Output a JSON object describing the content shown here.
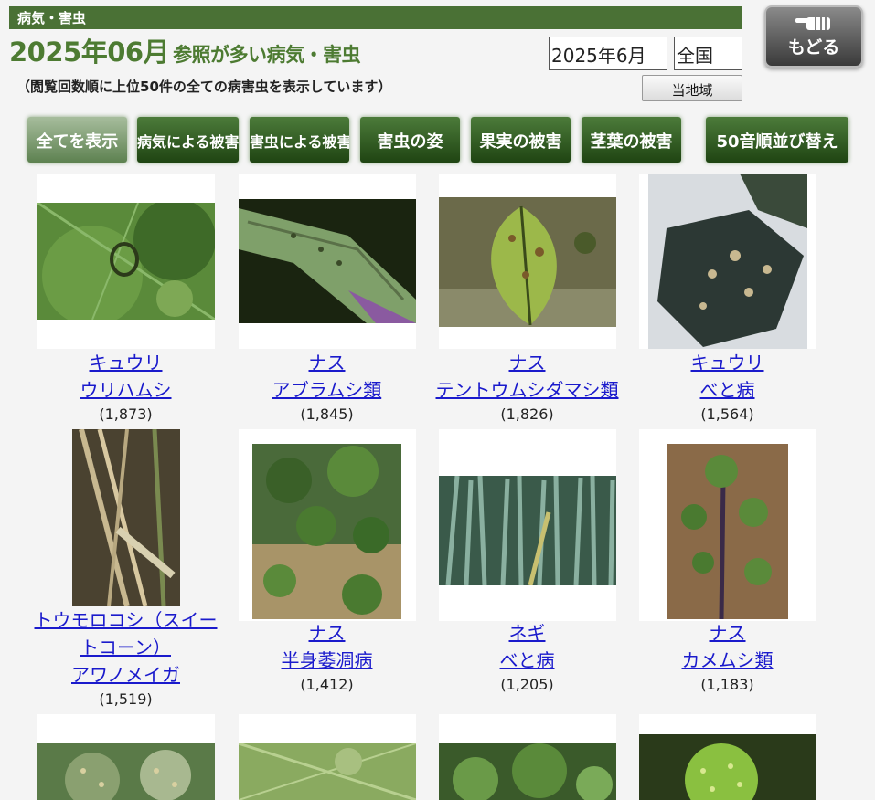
{
  "header": {
    "section": "病気・害虫",
    "title_main": "2025年06月",
    "title_sub": "参照が多い病気・害虫",
    "note": "（閲覧回数順に上位50件の全ての病害虫を表示しています）"
  },
  "controls": {
    "month": "2025年6月",
    "area": "全国",
    "local_button": "当地域",
    "back_button": "もどる"
  },
  "filters": [
    "全てを表示",
    "病気による被害",
    "害虫による被害",
    "害虫の姿",
    "果実の被害",
    "茎葉の被害",
    "50音順並び替え"
  ],
  "items": [
    {
      "crop": "キュウリ",
      "name": "ウリハムシ",
      "count": "(1,873)"
    },
    {
      "crop": "ナス",
      "name": "アブラムシ類",
      "count": "(1,845)"
    },
    {
      "crop": "ナス",
      "name": "テントウムシダマシ類",
      "count": "(1,826)"
    },
    {
      "crop": "キュウリ",
      "name": "べと病",
      "count": "(1,564)"
    },
    {
      "crop_line1": "トウモロコシ（スイー",
      "crop_line2": "トコーン）",
      "name": "アワノメイガ",
      "count": "(1,519)"
    },
    {
      "crop": "ナス",
      "name": "半身萎凋病",
      "count": "(1,412)"
    },
    {
      "crop": "ネギ",
      "name": "べと病",
      "count": "(1,205)"
    },
    {
      "crop": "ナス",
      "name": "カメムシ類",
      "count": "(1,183)"
    }
  ],
  "colors": {
    "accent_green": "#4a7135",
    "title_green": "#4d7b32",
    "link_blue": "#1a1acc"
  }
}
